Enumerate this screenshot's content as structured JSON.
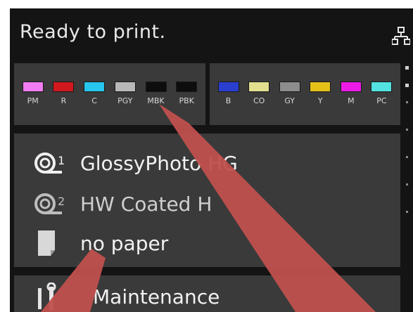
{
  "header": {
    "status": "Ready to print.",
    "network_icon": "network-icon"
  },
  "inks": {
    "left": [
      {
        "label": "PM",
        "color": "#f27cf2"
      },
      {
        "label": "R",
        "color": "#d0181f"
      },
      {
        "label": "C",
        "color": "#27c6ee"
      },
      {
        "label": "PGY",
        "color": "#b8b8b8"
      },
      {
        "label": "MBK",
        "color": "#0d0d0d"
      },
      {
        "label": "PBK",
        "color": "#0d0d0d"
      }
    ],
    "right": [
      {
        "label": "B",
        "color": "#2a3fd0"
      },
      {
        "label": "CO",
        "color": "#e2df8e"
      },
      {
        "label": "GY",
        "color": "#8d8d8d"
      },
      {
        "label": "Y",
        "color": "#e4c21a"
      },
      {
        "label": "M",
        "color": "#ec1be6"
      },
      {
        "label": "PC",
        "color": "#52e2e0"
      }
    ]
  },
  "paper": {
    "roll1": {
      "label": "GlossyPhoto HG"
    },
    "roll2": {
      "label": "HW Coated H"
    },
    "sheet": {
      "label": "no paper"
    }
  },
  "maintenance": {
    "label": "Maintenance"
  },
  "colors": {
    "panel": "#3a3a3a",
    "screen": "#141414",
    "callout": "#c0504d"
  }
}
